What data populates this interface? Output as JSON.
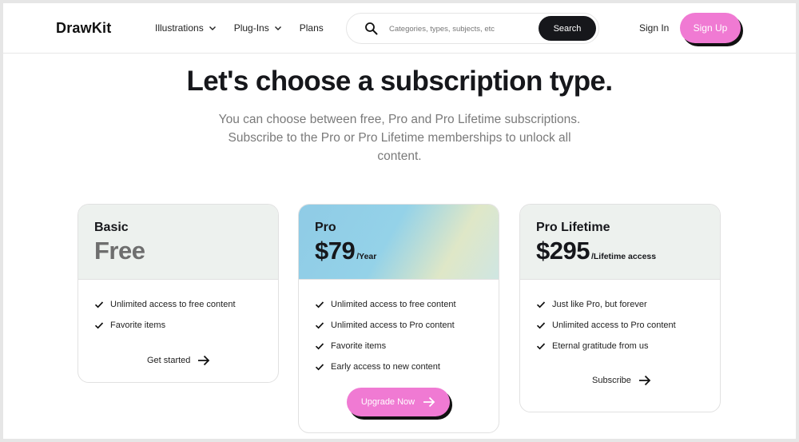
{
  "header": {
    "logo": "DrawKit",
    "nav": [
      {
        "label": "Illustrations"
      },
      {
        "label": "Plug-Ins"
      },
      {
        "label": "Plans"
      }
    ],
    "search": {
      "placeholder": "Categories, types, subjects, etc",
      "button_label": "Search"
    },
    "sign_in": "Sign In",
    "sign_up": "Sign Up"
  },
  "hero": {
    "title": "Let's choose a subscription type.",
    "subtitle": "You can choose between free, Pro and Pro Lifetime subscriptions. Subscribe to the Pro or Pro Lifetime memberships to unlock all content."
  },
  "plans": [
    {
      "name": "Basic",
      "price": "Free",
      "period": "",
      "features": [
        "Unlimited access to free content",
        "Favorite items"
      ],
      "cta": "Get started"
    },
    {
      "name": "Pro",
      "price": "$79",
      "period": "/Year",
      "features": [
        "Unlimited access to free content",
        "Unlimited access to Pro content",
        "Favorite items",
        "Early access to new content"
      ],
      "cta": "Upgrade Now"
    },
    {
      "name": "Pro Lifetime",
      "price": "$295",
      "period": "/Lifetime access",
      "features": [
        "Just like Pro, but forever",
        "Unlimited access to Pro content",
        "Eternal gratitude from us"
      ],
      "cta": "Subscribe"
    }
  ],
  "colors": {
    "accent": "#f07ad3",
    "dark": "#16171b",
    "card_head": "#edf1ee"
  }
}
